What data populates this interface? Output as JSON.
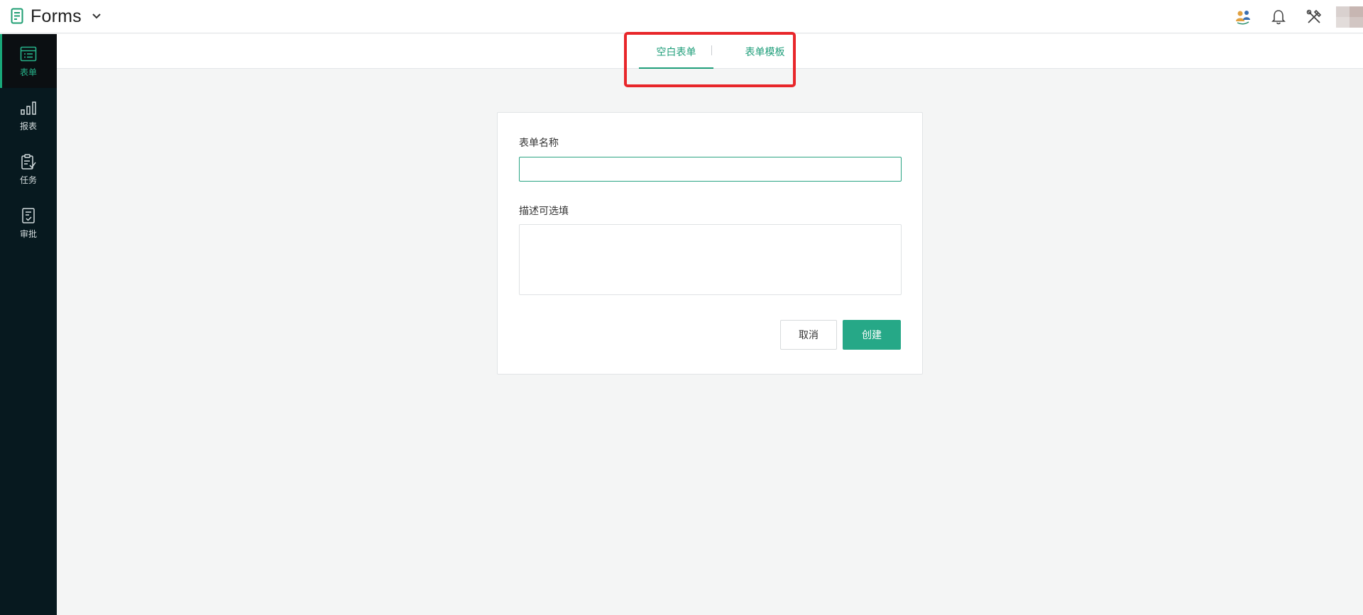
{
  "app": {
    "title": "Forms"
  },
  "header": {
    "icons": [
      "team-icon",
      "bell-icon",
      "tools-icon",
      "avatar"
    ]
  },
  "sidebar": {
    "items": [
      {
        "label": "表单",
        "icon": "form-list-icon",
        "active": true
      },
      {
        "label": "报表",
        "icon": "bar-chart-icon",
        "active": false
      },
      {
        "label": "任务",
        "icon": "clipboard-icon",
        "active": false
      },
      {
        "label": "审批",
        "icon": "approval-icon",
        "active": false
      }
    ]
  },
  "tabs": {
    "items": [
      {
        "label": "空白表单",
        "active": true
      },
      {
        "label": "表单模板",
        "active": false
      }
    ]
  },
  "form": {
    "name_label": "表单名称",
    "name_value": "",
    "desc_label": "描述可选填",
    "desc_value": "",
    "cancel_label": "取消",
    "create_label": "创建"
  },
  "colors": {
    "accent": "#26a887",
    "sidebar_bg": "#07191f",
    "highlight": "#e8262a"
  }
}
